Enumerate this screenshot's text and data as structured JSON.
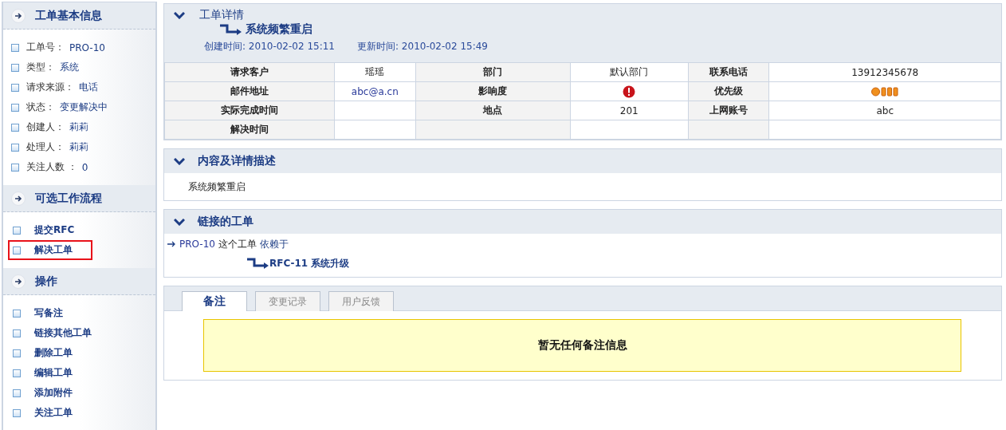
{
  "sidebar": {
    "sections": [
      {
        "title": "工单基本信息",
        "kind": "info",
        "items": [
          {
            "label": "工单号：",
            "value": "PRO-10"
          },
          {
            "label": "类型：",
            "value": "系统"
          },
          {
            "label": "请求来源：",
            "value": "电话"
          },
          {
            "label": "状态：",
            "value": "变更解决中"
          },
          {
            "label": "创建人：",
            "value": "莉莉"
          },
          {
            "label": "处理人：",
            "value": "莉莉"
          },
          {
            "label": "关注人数 ：",
            "value": "0"
          }
        ]
      },
      {
        "title": "可选工作流程",
        "kind": "links",
        "items": [
          {
            "text": "提交RFC",
            "highlighted": false
          },
          {
            "text": "解决工单",
            "highlighted": true
          }
        ]
      },
      {
        "title": "操作",
        "kind": "links",
        "items": [
          {
            "text": "写备注",
            "highlighted": false
          },
          {
            "text": "链接其他工单",
            "highlighted": false
          },
          {
            "text": "删除工单",
            "highlighted": false
          },
          {
            "text": "编辑工单",
            "highlighted": false
          },
          {
            "text": "添加附件",
            "highlighted": false
          },
          {
            "text": "关注工单",
            "highlighted": false
          }
        ]
      }
    ]
  },
  "detail": {
    "title": "工单详情",
    "subject": "系统频繁重启",
    "created_label": "创建时间:",
    "created": "2010-02-02 15:11",
    "updated_label": "更新时间:",
    "updated": "2010-02-02 15:49",
    "rows": [
      [
        {
          "kind": "label",
          "text": "请求客户"
        },
        {
          "kind": "value",
          "text": "瑶瑶"
        },
        {
          "kind": "label",
          "text": "部门"
        },
        {
          "kind": "value",
          "text": "默认部门"
        },
        {
          "kind": "label",
          "text": "联系电话"
        },
        {
          "kind": "value",
          "text": "13912345678"
        }
      ],
      [
        {
          "kind": "label",
          "text": "邮件地址"
        },
        {
          "kind": "link",
          "text": "abc@a.cn"
        },
        {
          "kind": "label",
          "text": "影响度"
        },
        {
          "kind": "impact"
        },
        {
          "kind": "label",
          "text": "优先级"
        },
        {
          "kind": "priority"
        }
      ],
      [
        {
          "kind": "label",
          "text": "实际完成时间"
        },
        {
          "kind": "value"
        },
        {
          "kind": "label",
          "text": "地点"
        },
        {
          "kind": "value",
          "text": "201"
        },
        {
          "kind": "label",
          "text": "上网账号"
        },
        {
          "kind": "value",
          "text": "abc"
        }
      ],
      [
        {
          "kind": "label",
          "text": "解决时间"
        },
        {
          "kind": "value"
        },
        {
          "kind": "label"
        },
        {
          "kind": "value"
        },
        {
          "kind": "label"
        },
        {
          "kind": "value"
        }
      ]
    ]
  },
  "description": {
    "title": "内容及详情描述",
    "text": "系统频繁重启"
  },
  "linked": {
    "title": "链接的工单",
    "source": "PRO-10",
    "middle": "这个工单",
    "relation": "依赖于",
    "target": "RFC-11 系统升级"
  },
  "notes": {
    "tabs": [
      {
        "label": "备注",
        "selected": true
      },
      {
        "label": "变更记录",
        "selected": false
      },
      {
        "label": "用户反馈",
        "selected": false
      }
    ],
    "empty_message": "暂无任何备注信息"
  }
}
